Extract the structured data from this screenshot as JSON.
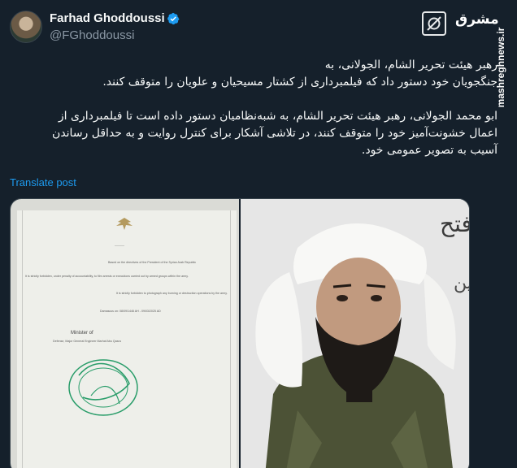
{
  "tweet": {
    "display_name": "Farhad Ghoddoussi",
    "handle": "@FGhoddoussi",
    "paragraph_1_line_1": "رهبر هیئت تحریر الشام، الجولانی، به",
    "paragraph_1_line_2": "جنگجویان خود دستور داد که  فیلمبرداری از کشتار مسیحیان و علویان را متوقف کنند.",
    "paragraph_2": "ابو محمد الجولانی، رهبر هیئت تحریر الشام، به شبه‌نظامیان دستور داده است تا فیلمبرداری از اعمال خشونت‌آمیز خود را متوقف کنند، در تلاشی آشکار برای کنترل روایت و به حداقل رساندن آسیب به تصویر عمومی خود.",
    "translate_label": "Translate post"
  },
  "branding": {
    "logo_text": "مشرق",
    "watermark": "mashreghnews.ir"
  },
  "media": {
    "document": {
      "line_1": "Based on the directives of the President of the Syrian Arab Republic",
      "line_2": "It is strictly forbidden, under penalty of accountability, to film arrests or executions carried out by armed groups within the army.",
      "line_3": "It is strictly forbidden to photograph any burning or destruction operations by the army.",
      "date_line": "Damascus on: 08/09/1446 AH - 09/03/2025 AD",
      "minister_label": "Minister of",
      "minister_name": "Defense, Major General Engineer Marhaf Abu Qasra"
    }
  },
  "colors": {
    "background": "#15202b",
    "text": "#f7f9f9",
    "secondary_text": "#8b98a5",
    "link": "#1d9bf0",
    "verified": "#1d9bf0",
    "stamp": "#2a9d6a"
  },
  "icons": {
    "verified": "verified-badge-icon",
    "grok": "grok-icon"
  }
}
